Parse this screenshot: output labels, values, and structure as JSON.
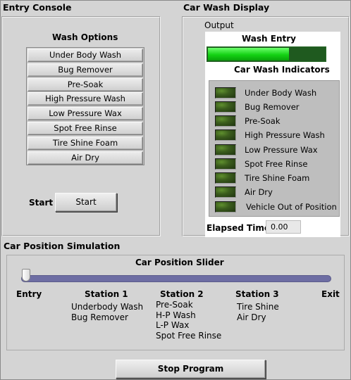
{
  "entry_console": {
    "title": "Entry Console",
    "wash_options_title": "Wash Options",
    "options": [
      "Under Body Wash",
      "Bug Remover",
      "Pre-Soak",
      "High Pressure Wash",
      "Low Pressure Wax",
      "Spot Free Rinse",
      "Tire Shine Foam",
      "Air Dry"
    ],
    "start_label": "Start",
    "start_button": "Start"
  },
  "display": {
    "title": "Car Wash Display",
    "output_label": "Output",
    "wash_entry_label": "Wash Entry",
    "wash_entry_progress": 0.69,
    "indicators_title": "Car Wash Indicators",
    "indicators": [
      "Under Body Wash",
      "Bug Remover",
      "Pre-Soak",
      "High Pressure Wash",
      "Low Pressure Wax",
      "Spot Free Rinse",
      "Tire Shine Foam",
      "Air Dry",
      "Vehicle Out of Position"
    ],
    "elapsed_label": "Elapsed Time",
    "elapsed_value": "0.00"
  },
  "simulation": {
    "title": "Car Position Simulation",
    "slider_label": "Car Position Slider",
    "slider_position": 0,
    "stations": {
      "entry": "Entry",
      "station1": "Station 1",
      "station2": "Station 2",
      "station3": "Station 3",
      "exit": "Exit"
    },
    "station1_items": [
      "Underbody Wash",
      "Bug Remover"
    ],
    "station2_items": [
      "Pre-Soak",
      "H-P Wash",
      "L-P Wax",
      "Spot Free Rinse"
    ],
    "station3_items": [
      "Tire Shine",
      "Air Dry"
    ]
  },
  "stop_button": "Stop  Program",
  "colors": {
    "background": "#d4d4d4",
    "progress_green": "#14d214",
    "slider_track": "#6d6da3",
    "led_off": "#3b5d1d"
  }
}
